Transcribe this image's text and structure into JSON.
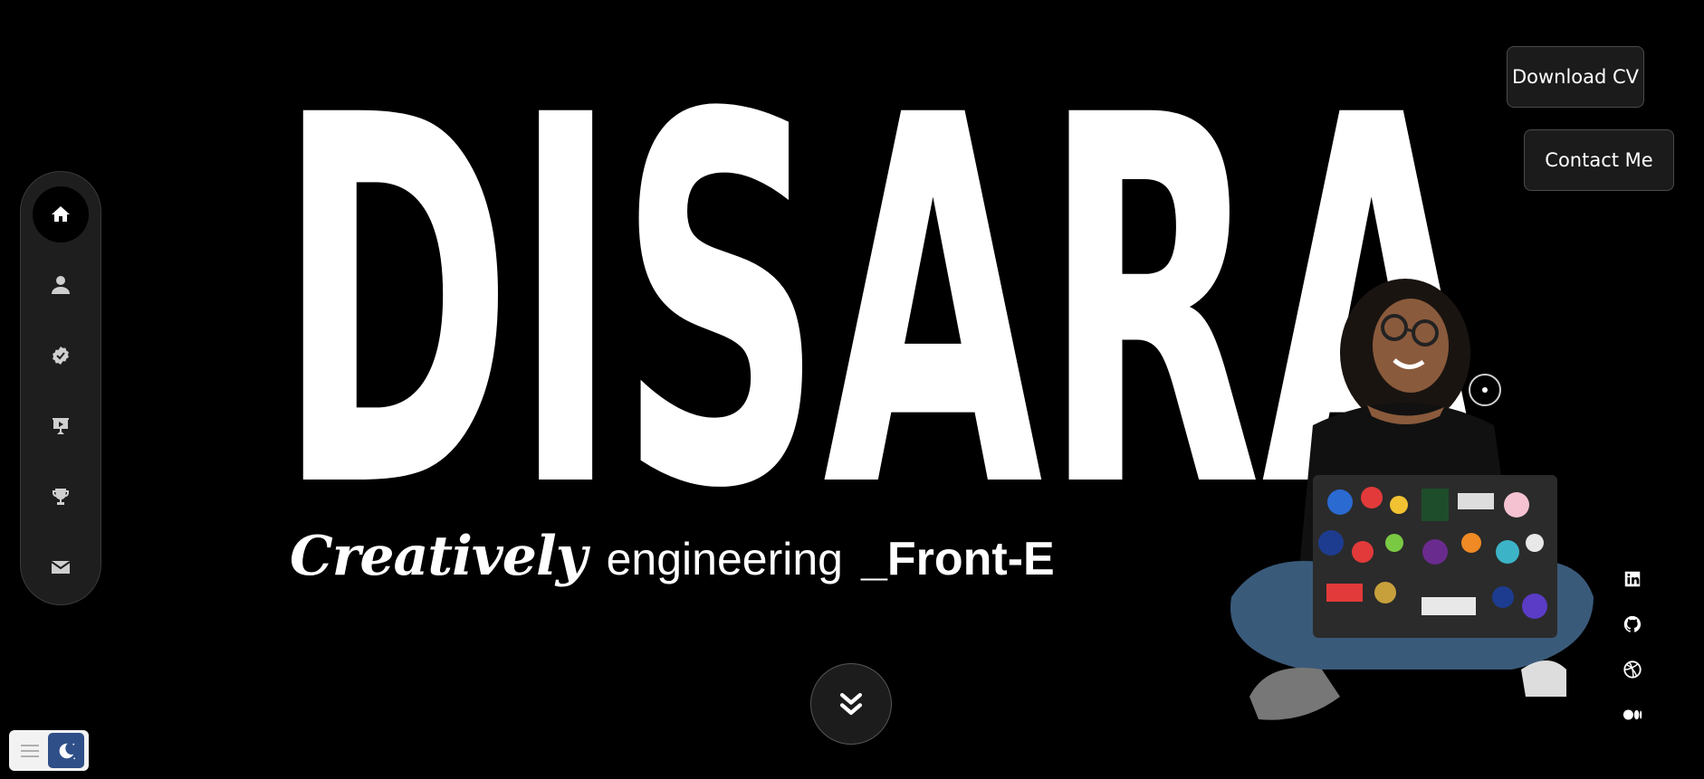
{
  "hero": {
    "name": "DISARA"
  },
  "tagline": {
    "creatively": "Creatively",
    "engineering": "engineering",
    "role": "_Front-E"
  },
  "buttons": {
    "download_cv": "Download CV",
    "contact_me": "Contact Me"
  },
  "side_nav": {
    "items": [
      {
        "icon": "home-icon",
        "active": true
      },
      {
        "icon": "user-icon",
        "active": false
      },
      {
        "icon": "verified-badge-icon",
        "active": false
      },
      {
        "icon": "presentation-icon",
        "active": false
      },
      {
        "icon": "trophy-icon",
        "active": false
      },
      {
        "icon": "mail-icon",
        "active": false
      }
    ]
  },
  "social": [
    {
      "icon": "linkedin-icon"
    },
    {
      "icon": "github-icon"
    },
    {
      "icon": "dribbble-icon"
    },
    {
      "icon": "medium-icon"
    }
  ],
  "theme_toggle": {
    "icons": [
      "menu-icon",
      "moon-icon"
    ]
  },
  "colors": {
    "background": "#000000",
    "text": "#ffffff",
    "nav_background": "#1e1e1e",
    "toggle_moon": "#2f4f88"
  }
}
